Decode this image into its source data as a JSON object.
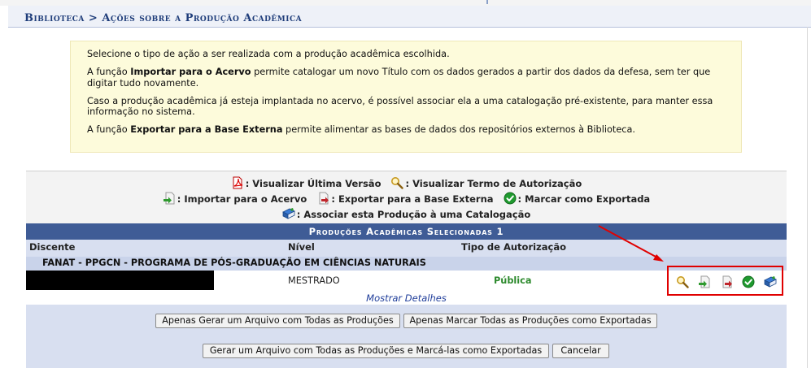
{
  "breadcrumb": "Biblioteca > Ações sobre a Produção Acadêmica",
  "info": {
    "p1": "Selecione o tipo de ação a ser realizada com a produção acadêmica escolhida.",
    "p2_pre": "A função ",
    "p2_bold": "Importar para o Acervo",
    "p2_post": " permite catalogar um novo Título com os dados gerados a partir dos dados da defesa, sem ter que digitar tudo novamente.",
    "p3": "Caso a produção acadêmica já esteja implantada no acervo, é possível associar ela a uma catalogação pré-existente, para manter essa informação no sistema.",
    "p4_pre": "A função ",
    "p4_bold": "Exportar para a Base Externa",
    "p4_post": " permite alimentar as bases de dados dos repositórios externos à Biblioteca."
  },
  "legend": {
    "view_last": ": Visualizar Última Versão",
    "view_term": ": Visualizar Termo de Autorização",
    "import": ": Importar para o Acervo",
    "export": ": Exportar para a Base Externa",
    "mark": ": Marcar como Exportada",
    "associate": ": Associar esta Produção à uma Catalogação"
  },
  "panel": {
    "title": "Produções Acadêmicas Selecionadas 1",
    "col_discente": "Discente",
    "col_nivel": "Nível",
    "col_tipo": "Tipo de Autorização",
    "group": "FANAT - PPGCN - PROGRAMA DE PÓS-GRADUAÇÃO EM CIÊNCIAS NATURAIS",
    "row": {
      "nivel": "MESTRADO",
      "tipo": "Pública"
    },
    "details": "Mostrar Detalhes"
  },
  "buttons": {
    "gen_all": "Apenas Gerar um Arquivo com Todas as Produções",
    "mark_all": "Apenas Marcar Todas as Produções como Exportadas",
    "gen_mark": "Gerar um Arquivo com Todas as Produções e Marcá-las como Exportadas",
    "cancel": "Cancelar"
  },
  "colors": {
    "accent": "#3f5c96",
    "highlight": "#e00000",
    "publica": "#2d8a2d"
  }
}
